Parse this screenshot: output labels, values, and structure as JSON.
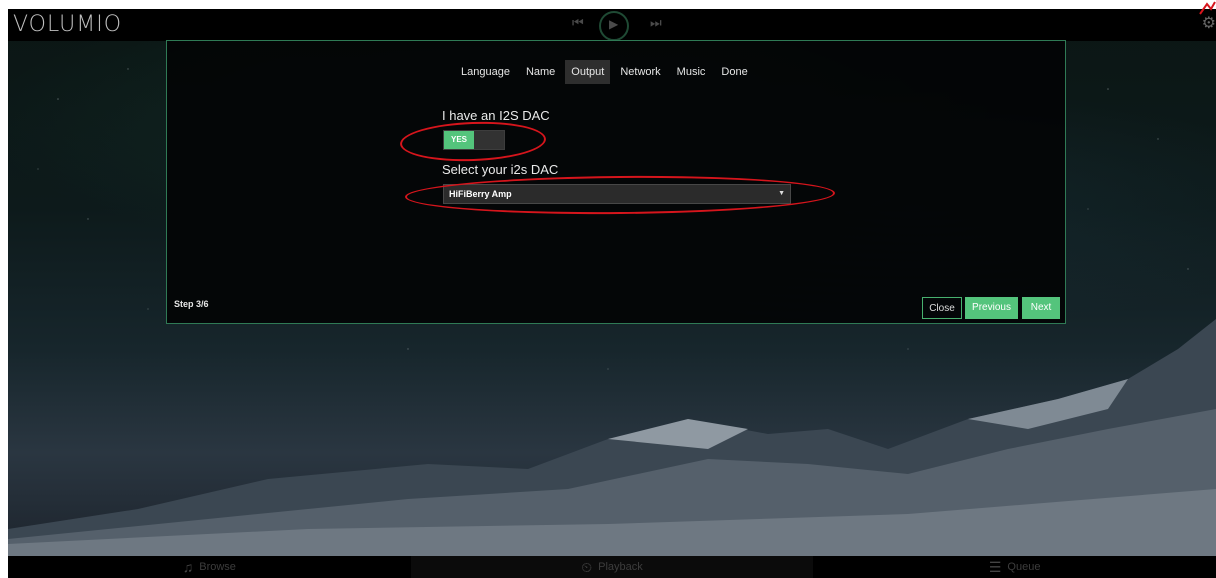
{
  "app": {
    "logo": "VOLUMIO"
  },
  "transport": {
    "prev_icon": "⏮",
    "play_icon": "▶",
    "next_icon": "⏭"
  },
  "settings_icon": "⚙",
  "wizard": {
    "tabs": [
      {
        "label": "Language"
      },
      {
        "label": "Name"
      },
      {
        "label": "Output",
        "active": true
      },
      {
        "label": "Network"
      },
      {
        "label": "Music"
      },
      {
        "label": "Done"
      }
    ],
    "i2s_label": "I have an I2S DAC",
    "i2s_toggle": "YES",
    "dac_label": "Select your i2s DAC",
    "dac_selected": "HiFiBerry Amp",
    "step": "Step 3/6",
    "close_label": "Close",
    "previous_label": "Previous",
    "next_label": "Next"
  },
  "bottom_nav": {
    "browse": {
      "label": "Browse",
      "icon": "♫"
    },
    "playback": {
      "label": "Playback",
      "icon": "⏲"
    },
    "queue": {
      "label": "Queue",
      "icon": "☰"
    }
  },
  "colors": {
    "accent": "#54c47c",
    "annotation": "#d6151c"
  }
}
